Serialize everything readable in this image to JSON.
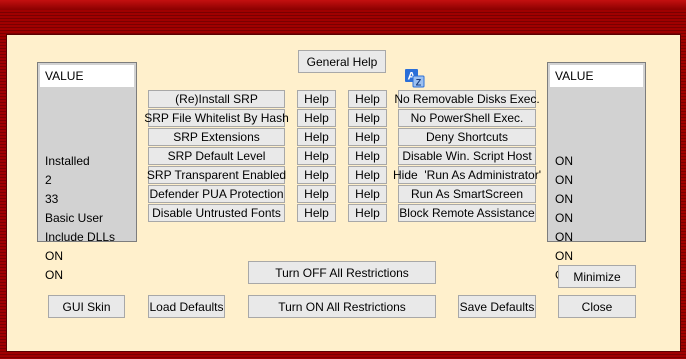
{
  "left_list": {
    "header": "VALUE",
    "rows": [
      "Installed",
      "2",
      "33",
      "Basic User",
      "Include DLLs",
      "ON",
      "ON"
    ]
  },
  "right_list": {
    "header": "VALUE",
    "rows": [
      "ON",
      "ON",
      "ON",
      "ON",
      "ON",
      "ON",
      "ON"
    ]
  },
  "general_help": "General Help",
  "left_buttons": [
    "(Re)Install SRP",
    "SRP File Whitelist By Hash",
    "SRP Extensions",
    "SRP Default Level",
    "SRP Transparent Enabled",
    "Defender PUA Protection",
    "Disable Untrusted Fonts"
  ],
  "help_label": "Help",
  "right_buttons": [
    "No Removable Disks Exec.",
    "No PowerShell Exec.",
    "Deny Shortcuts",
    "Disable Win. Script Host",
    "Hide  'Run As Administrator'",
    "Run As SmartScreen",
    "Block Remote Assistance"
  ],
  "turn_off_all": "Turn OFF All Restrictions",
  "turn_on_all": "Turn ON All Restrictions",
  "minimize": "Minimize",
  "gui_skin": "GUI Skin",
  "load_defaults": "Load Defaults",
  "save_defaults": "Save Defaults",
  "close": "Close",
  "colors": {
    "panel": "#fff0cc",
    "frame": "#8a0000",
    "icon_blue": "#2b6fd8"
  },
  "icons": {
    "az": "sort-az-icon"
  }
}
